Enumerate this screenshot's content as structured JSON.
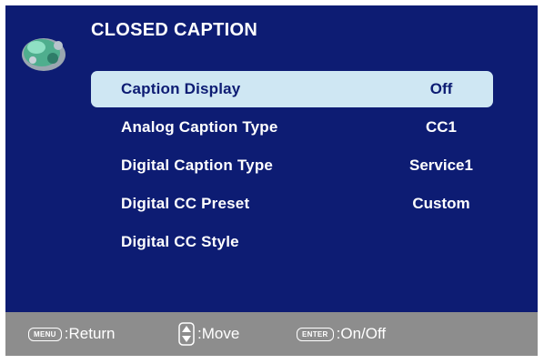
{
  "title": "CLOSED CAPTION",
  "menu": [
    {
      "label": "Caption Display",
      "value": "Off",
      "selected": true
    },
    {
      "label": "Analog Caption Type",
      "value": "CC1",
      "selected": false
    },
    {
      "label": "Digital Caption Type",
      "value": "Service1",
      "selected": false
    },
    {
      "label": "Digital CC Preset",
      "value": "Custom",
      "selected": false
    },
    {
      "label": "Digital CC Style",
      "value": "",
      "selected": false
    }
  ],
  "footer": {
    "menu_key": "MENU",
    "return_text": ":Return",
    "move_icon": "up-down-arrows-icon",
    "move_text": ":Move",
    "enter_key": "ENTER",
    "onoff_text": ":On/Off"
  },
  "colors": {
    "panel": "#0d1c73",
    "highlight": "#cfe7f3",
    "footer": "#8d8d8d",
    "text": "#ffffff"
  }
}
